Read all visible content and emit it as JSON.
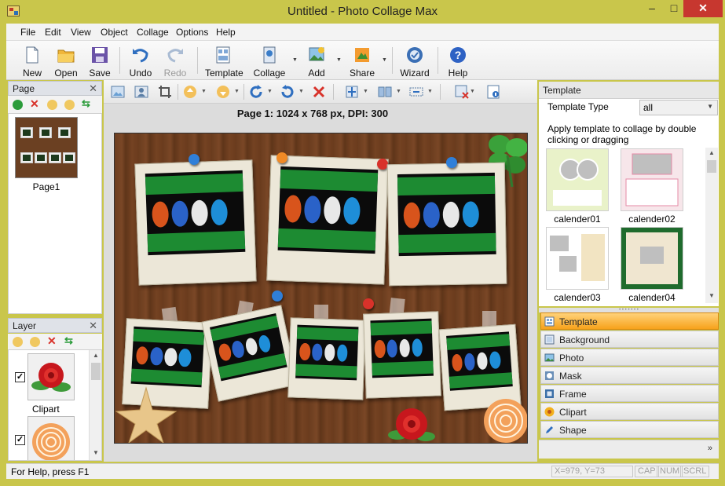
{
  "window": {
    "title": "Untitled - Photo Collage Max",
    "controls": [
      "–",
      "□",
      "✕"
    ]
  },
  "menu": [
    "File",
    "Edit",
    "View",
    "Object",
    "Collage",
    "Options",
    "Help"
  ],
  "toolbar": {
    "new": "New",
    "open": "Open",
    "save": "Save",
    "undo": "Undo",
    "redo": "Redo",
    "template": "Template",
    "collage": "Collage",
    "add": "Add",
    "share": "Share",
    "wizard": "Wizard",
    "help": "Help"
  },
  "page_panel": {
    "title": "Page",
    "close": "✕",
    "page_label": "Page1"
  },
  "layer_panel": {
    "title": "Layer",
    "close": "✕",
    "items": [
      {
        "label": "Clipart",
        "checked": "✓"
      },
      {
        "label": "",
        "checked": "✓"
      }
    ]
  },
  "canvas": {
    "page_info": "Page 1: 1024 x 768 px, DPI: 300"
  },
  "template_panel": {
    "title": "Template",
    "type_label": "Template Type",
    "type_value": "all",
    "note": "Apply template to collage by double clicking or dragging",
    "items": [
      "calender01",
      "calender02",
      "calender03",
      "calender04"
    ]
  },
  "categories": [
    "Template",
    "Background",
    "Photo",
    "Mask",
    "Frame",
    "Clipart",
    "Shape"
  ],
  "statusbar": {
    "help": "For Help, press F1",
    "coords": "X=979, Y=73",
    "cap": "CAP",
    "num": "NUM",
    "scrl": "SCRL"
  },
  "colors": {
    "accent": "#f7a21b",
    "titlebar": "#c9c64b",
    "close": "#c7372f"
  }
}
